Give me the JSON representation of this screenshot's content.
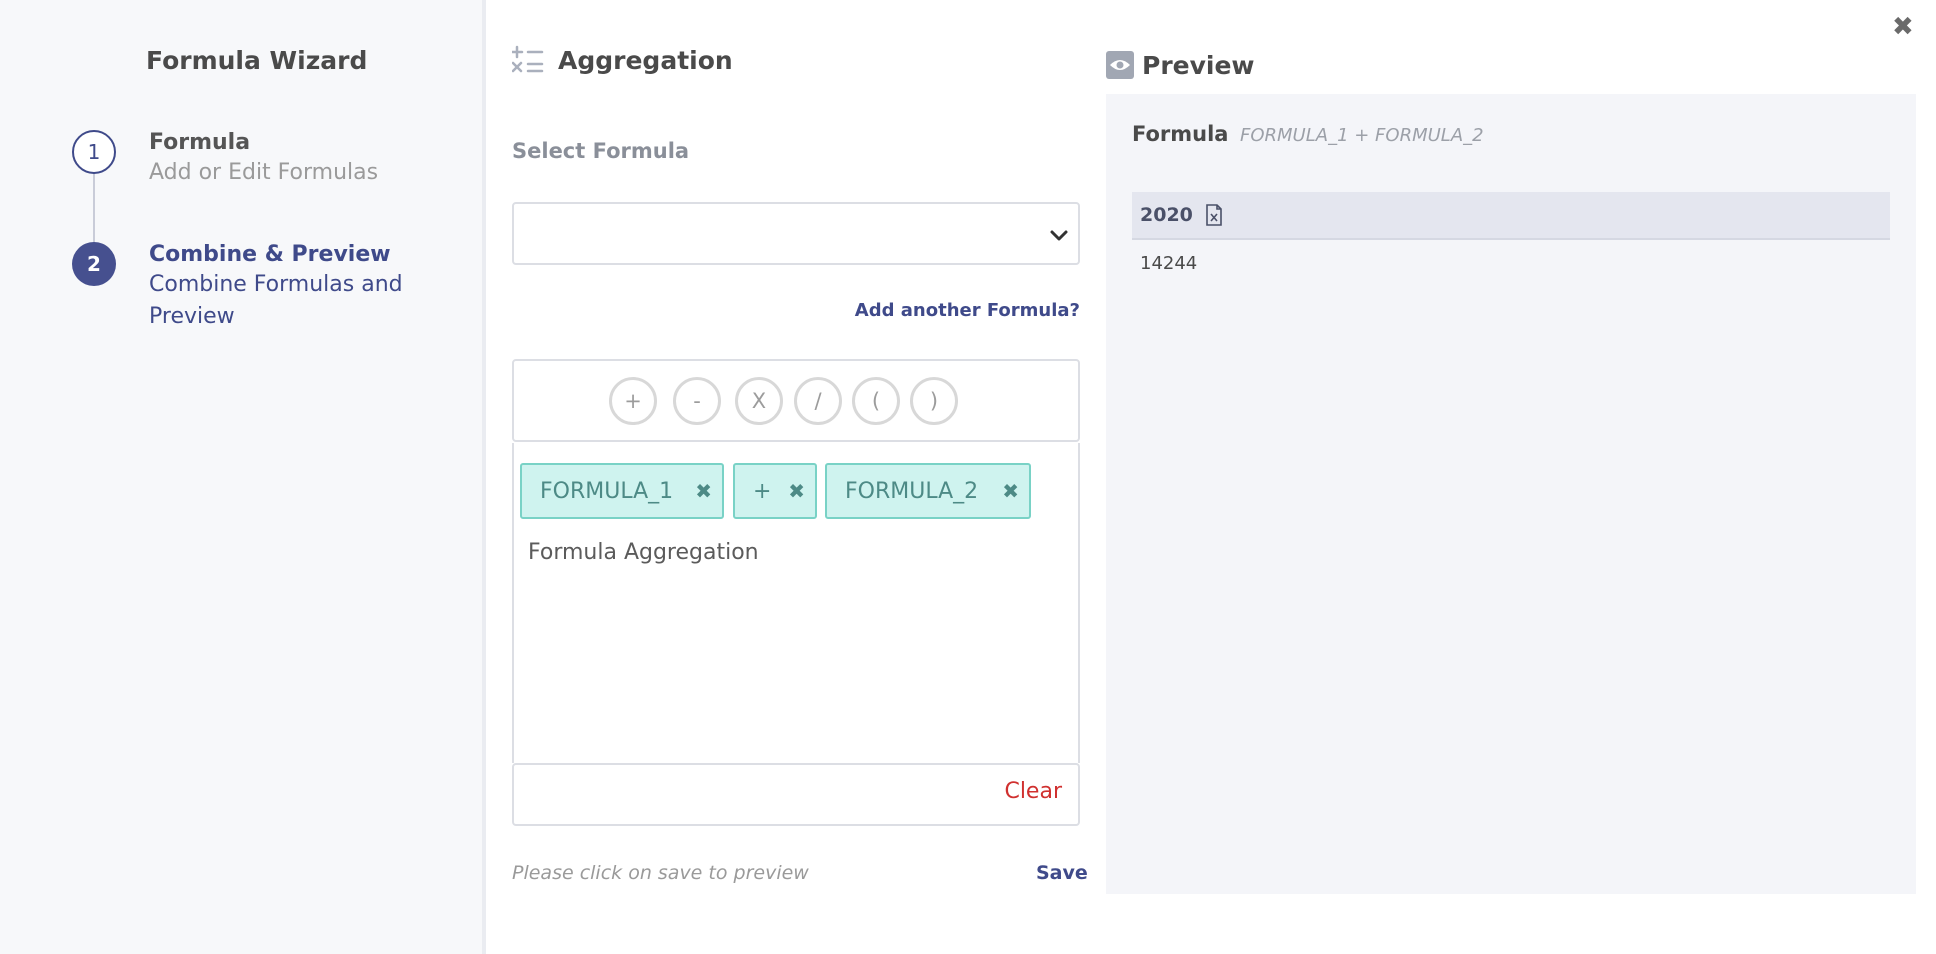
{
  "sidebar": {
    "title": "Formula Wizard",
    "steps": [
      {
        "number": "1",
        "title": "Formula",
        "subtitle": "Add or Edit Formulas",
        "state": "complete"
      },
      {
        "number": "2",
        "title": "Combine & Preview",
        "subtitle": "Combine Formulas and Preview",
        "state": "active"
      }
    ]
  },
  "aggregation": {
    "title": "Aggregation",
    "icon": "formula-operators-icon",
    "select_label": "Select Formula",
    "select_value": "",
    "add_formula_link": "Add another Formula?",
    "operators": [
      "+",
      "-",
      "X",
      "/",
      "(",
      ")"
    ],
    "tokens": [
      {
        "label": "FORMULA_1",
        "remove_symbol": "✖"
      },
      {
        "label": "+",
        "remove_symbol": "✖"
      },
      {
        "label": "FORMULA_2",
        "remove_symbol": "✖"
      }
    ],
    "expression_name": "Formula Aggregation",
    "clear_label": "Clear",
    "hint": "Please click on save to preview",
    "save_label": "Save"
  },
  "preview": {
    "title": "Preview",
    "icon": "eye-icon",
    "close_symbol": "✖",
    "formula_label": "Formula",
    "formula_expression": "FORMULA_1 + FORMULA_2",
    "table": {
      "header": "2020",
      "header_icon": "excel-file-icon",
      "value": "14244"
    }
  },
  "colors": {
    "accent": "#3f4a8a",
    "chip_bg": "#cff3ef",
    "chip_border": "#79d2c6",
    "danger": "#d0302f",
    "panel_bg": "#f4f5f9"
  }
}
